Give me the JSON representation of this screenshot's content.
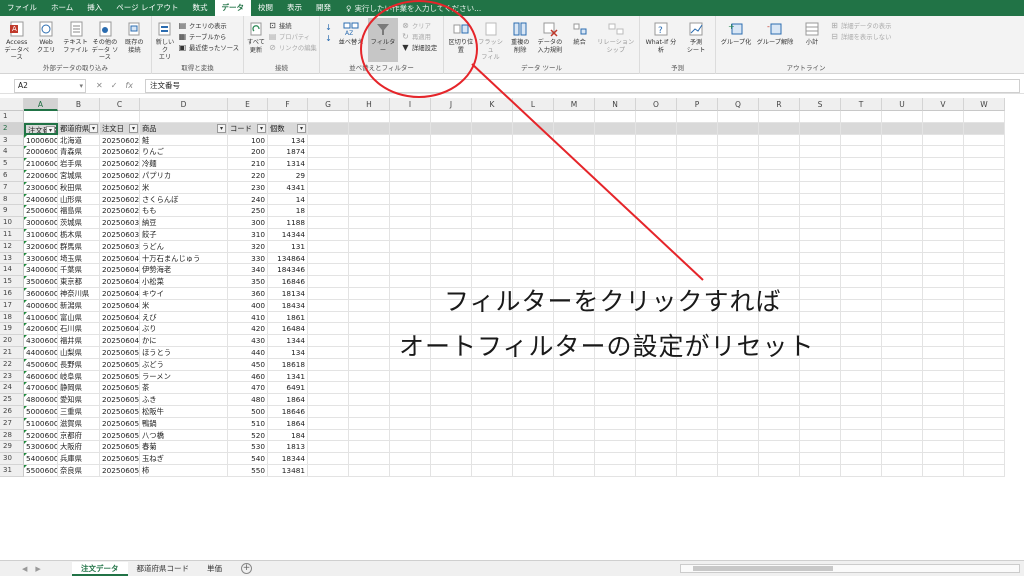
{
  "menu": {
    "tabs": [
      "ファイル",
      "ホーム",
      "挿入",
      "ページ レイアウト",
      "数式",
      "データ",
      "校閲",
      "表示",
      "開発"
    ],
    "active_index": 5,
    "tell_me": "実行したい作業を入力してください..."
  },
  "ribbon": {
    "get_external": {
      "label": "外部データの取り込み",
      "access": "Access\nデータベース",
      "web": "Web\nクエリ",
      "text": "テキスト\nファイル",
      "other": "その他の\nデータ ソース",
      "existing": "既存の\n接続"
    },
    "transform": {
      "label": "取得と変換",
      "new_query": "新しいク\nエリ",
      "show_queries": "クエリの表示",
      "from_table": "テーブルから",
      "recent_sources": "最近使ったソース"
    },
    "connections": {
      "label": "接続",
      "refresh_all": "すべて\n更新",
      "connections": "接続",
      "properties": "プロパティ",
      "edit_links": "リンクの編集"
    },
    "sort_filter": {
      "label": "並べ替えとフィルター",
      "sort": "並べ替え",
      "filter": "フィルター",
      "clear": "クリア",
      "reapply": "再適用",
      "advanced": "詳細設定"
    },
    "data_tools": {
      "label": "データ ツール",
      "text_to_columns": "区切り位置",
      "flash_fill": "フラッシュ\nフィル",
      "remove_dup": "重複の\n削除",
      "validation": "データの\n入力規則",
      "consolidate": "統合",
      "relationships": "リレーションシップ"
    },
    "forecast": {
      "label": "予測",
      "what_if": "What-If 分析",
      "forecast_sheet": "予測\nシート"
    },
    "outline": {
      "label": "アウトライン",
      "group": "グループ化",
      "ungroup": "グループ解除",
      "subtotal": "小計",
      "show_detail": "詳細データの表示",
      "hide_detail": "詳細を表示しない"
    }
  },
  "formula_bar": {
    "name_box": "A2",
    "content": "注文番号"
  },
  "columns": [
    "A",
    "B",
    "C",
    "D",
    "E",
    "F",
    "G",
    "H",
    "I",
    "J",
    "K",
    "L",
    "M",
    "N",
    "O",
    "P",
    "Q",
    "R",
    "S",
    "T",
    "U",
    "V",
    "W"
  ],
  "header_row": [
    "注文番号",
    "都道府県",
    "注文日",
    "商品",
    "コード",
    "個数"
  ],
  "rows": [
    [
      "10006001",
      "北海道",
      "20250602",
      "鮭",
      "100",
      "134"
    ],
    [
      "20006001",
      "青森県",
      "20250602",
      "りんご",
      "200",
      "1874"
    ],
    [
      "21006001",
      "岩手県",
      "20250602",
      "冷麺",
      "210",
      "1314"
    ],
    [
      "22006001",
      "宮城県",
      "20250602",
      "パプリカ",
      "220",
      "29"
    ],
    [
      "23006001",
      "秋田県",
      "20250602",
      "米",
      "230",
      "4341"
    ],
    [
      "24006001",
      "山形県",
      "20250602",
      "さくらんぼ",
      "240",
      "14"
    ],
    [
      "25006001",
      "福島県",
      "20250602",
      "もも",
      "250",
      "18"
    ],
    [
      "30006001",
      "茨城県",
      "20250603",
      "納豆",
      "300",
      "1188"
    ],
    [
      "31006001",
      "栃木県",
      "20250603",
      "餃子",
      "310",
      "14344"
    ],
    [
      "32006001",
      "群馬県",
      "20250603",
      "うどん",
      "320",
      "131"
    ],
    [
      "33006001",
      "埼玉県",
      "20250604",
      "十万石まんじゅう",
      "330",
      "134864"
    ],
    [
      "34006001",
      "千葉県",
      "20250604",
      "伊勢海老",
      "340",
      "184346"
    ],
    [
      "35006001",
      "東京都",
      "20250604",
      "小松菜",
      "350",
      "16846"
    ],
    [
      "36006001",
      "神奈川県",
      "20250604",
      "キウイ",
      "360",
      "18134"
    ],
    [
      "40006001",
      "新潟県",
      "20250604",
      "米",
      "400",
      "18434"
    ],
    [
      "41006001",
      "富山県",
      "20250604",
      "えび",
      "410",
      "1861"
    ],
    [
      "42006001",
      "石川県",
      "20250604",
      "ぶり",
      "420",
      "16484"
    ],
    [
      "43006001",
      "福井県",
      "20250604",
      "かに",
      "430",
      "1344"
    ],
    [
      "44006001",
      "山梨県",
      "20250605",
      "ほうとう",
      "440",
      "134"
    ],
    [
      "45006001",
      "長野県",
      "20250605",
      "ぶどう",
      "450",
      "18618"
    ],
    [
      "46006001",
      "岐阜県",
      "20250605",
      "ラーメン",
      "460",
      "1341"
    ],
    [
      "47006001",
      "静岡県",
      "20250605",
      "茶",
      "470",
      "6491"
    ],
    [
      "48006001",
      "愛知県",
      "20250605",
      "ふき",
      "480",
      "1864"
    ],
    [
      "50006001",
      "三重県",
      "20250605",
      "松阪牛",
      "500",
      "18646"
    ],
    [
      "51006001",
      "滋賀県",
      "20250605",
      "鴨鍋",
      "510",
      "1864"
    ],
    [
      "52006001",
      "京都府",
      "20250605",
      "八つ橋",
      "520",
      "184"
    ],
    [
      "53006001",
      "大阪府",
      "20250605",
      "春菊",
      "530",
      "1813"
    ],
    [
      "54006001",
      "兵庫県",
      "20250605",
      "玉ねぎ",
      "540",
      "18344"
    ],
    [
      "55006001",
      "奈良県",
      "20250605",
      "柿",
      "550",
      "13481"
    ]
  ],
  "sheets": [
    "注文データ",
    "都道府県コード",
    "単価"
  ],
  "active_sheet": 0,
  "annotation": {
    "line1": "フィルターをクリックすれば",
    "line2": "オートフィルターの設定がリセット",
    "color": "#e5252a"
  },
  "colors": {
    "excel_green": "#217346",
    "header_fill": "#d9d9d9"
  }
}
